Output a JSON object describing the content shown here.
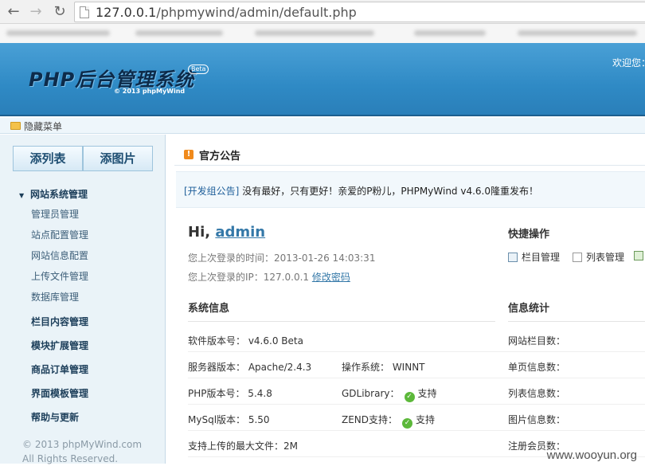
{
  "browser": {
    "url_host": "127.0.0.1",
    "url_path": "/phpmywind/admin/default.php"
  },
  "header": {
    "logo_title": "PHP后台管理系统",
    "logo_badge": "Beta",
    "logo_copyright": "© 2013 phpMyWind",
    "welcome": "欢迎您："
  },
  "hide_menu_label": "隐藏菜单",
  "sidebar": {
    "tabs": [
      "添列表",
      "添图片"
    ],
    "group_title": "网站系统管理",
    "sub_items": [
      "管理员管理",
      "站点配置管理",
      "网站信息配置",
      "上传文件管理",
      "数据库管理"
    ],
    "menu_items": [
      "栏目内容管理",
      "模块扩展管理",
      "商品订单管理",
      "界面模板管理",
      "帮助与更新"
    ],
    "footer_line1": "© 2013 phpMyWind.com",
    "footer_line2": "All Rights Reserved."
  },
  "notice": {
    "title": "官方公告",
    "tag": "[开发组公告]",
    "text": " 没有最好，只有更好！亲爱的P粉儿，PHPMyWind v4.6.0隆重发布！"
  },
  "login": {
    "hi": "Hi, ",
    "username": "admin",
    "last_time": "您上次登录的时间：2013-01-26 14:03:31",
    "last_ip": "您上次登录的IP：127.0.0.1 ",
    "change_pwd": "修改密码"
  },
  "quick": {
    "title": "快捷操作",
    "items": [
      "栏目管理",
      "列表管理"
    ]
  },
  "system_info": {
    "title": "系统信息",
    "version": "软件版本号：  v4.6.0 Beta",
    "server": "服务器版本：  Apache/2.4.3",
    "os": "操作系统：  WINNT",
    "php": "PHP版本号：  5.4.8",
    "gd_label": "GDLibrary：",
    "gd_value": "支持",
    "mysql": "MySql版本：  5.50",
    "zend_label": "ZEND支持：",
    "zend_value": "支持",
    "upload_max": "支持上传的最大文件：2M"
  },
  "stats": {
    "title": "信息统计",
    "items": [
      "网站栏目数：",
      "单页信息数：",
      "列表信息数：",
      "图片信息数：",
      "注册会员数："
    ]
  },
  "watermark": "www.wooyun.org"
}
